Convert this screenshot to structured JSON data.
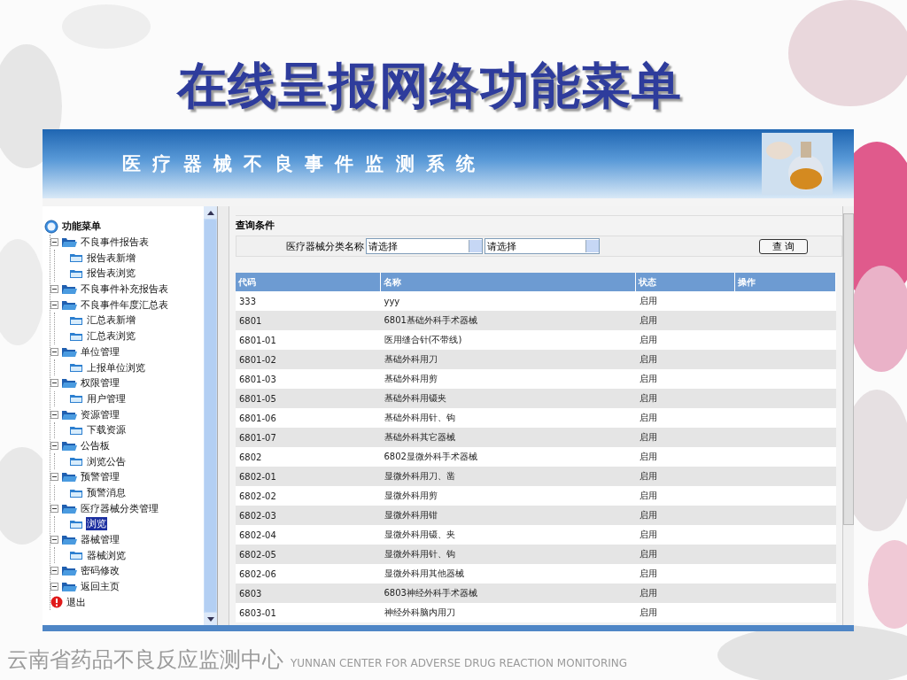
{
  "slide": {
    "title": "在线呈报网络功能菜单",
    "footer_cn": "云南省药品不良反应监测中心",
    "footer_en": "YUNNAN CENTER FOR ADVERSE DRUG REACTION MONITORING"
  },
  "app": {
    "banner_title": "医 疗 器 械 不 良 事 件 监 测 系 统"
  },
  "menu": {
    "label": "功能菜单",
    "kind": "root",
    "selected": false,
    "children": [
      {
        "label": "不良事件报告表",
        "kind": "folder",
        "selected": false,
        "children": [
          {
            "label": "报告表新增",
            "kind": "leaf",
            "selected": false
          },
          {
            "label": "报告表浏览",
            "kind": "leaf",
            "selected": false
          }
        ]
      },
      {
        "label": "不良事件补充报告表",
        "kind": "folder",
        "selected": false
      },
      {
        "label": "不良事件年度汇总表",
        "kind": "folder",
        "selected": false,
        "children": [
          {
            "label": "汇总表新增",
            "kind": "leaf",
            "selected": false
          },
          {
            "label": "汇总表浏览",
            "kind": "leaf",
            "selected": false
          }
        ]
      },
      {
        "label": "单位管理",
        "kind": "folder",
        "selected": false,
        "children": [
          {
            "label": "上报单位浏览",
            "kind": "leaf",
            "selected": false
          }
        ]
      },
      {
        "label": "权限管理",
        "kind": "folder",
        "selected": false,
        "children": [
          {
            "label": "用户管理",
            "kind": "leaf",
            "selected": false
          }
        ]
      },
      {
        "label": "资源管理",
        "kind": "folder",
        "selected": false,
        "children": [
          {
            "label": "下载资源",
            "kind": "leaf",
            "selected": false
          }
        ]
      },
      {
        "label": "公告板",
        "kind": "folder",
        "selected": false,
        "children": [
          {
            "label": "浏览公告",
            "kind": "leaf",
            "selected": false
          }
        ]
      },
      {
        "label": "预警管理",
        "kind": "folder",
        "selected": false,
        "children": [
          {
            "label": "预警消息",
            "kind": "leaf",
            "selected": false
          }
        ]
      },
      {
        "label": "医疗器械分类管理",
        "kind": "folder",
        "selected": false,
        "children": [
          {
            "label": "浏览",
            "kind": "leaf",
            "selected": true
          }
        ]
      },
      {
        "label": "器械管理",
        "kind": "folder",
        "selected": false,
        "children": [
          {
            "label": "器械浏览",
            "kind": "leaf",
            "selected": false
          }
        ]
      },
      {
        "label": "密码修改",
        "kind": "folder",
        "selected": false
      },
      {
        "label": "返回主页",
        "kind": "folder",
        "selected": false
      },
      {
        "label": "退出",
        "kind": "exit",
        "selected": false
      }
    ]
  },
  "query": {
    "heading": "查询条件",
    "field_label": "医疗器械分类名称",
    "select_1": "请选择",
    "select_2": "请选择",
    "button": "查 询"
  },
  "table": {
    "columns": [
      "代码",
      "名称",
      "状态",
      "操作"
    ],
    "rows": [
      [
        "333",
        "yyy",
        "启用"
      ],
      [
        "6801",
        "6801基础外科手术器械",
        "启用"
      ],
      [
        "6801-01",
        "医用缝合针(不带线)",
        "启用"
      ],
      [
        "6801-02",
        "基础外科用刀",
        "启用"
      ],
      [
        "6801-03",
        "基础外科用剪",
        "启用"
      ],
      [
        "6801-05",
        "基础外科用镊夹",
        "启用"
      ],
      [
        "6801-06",
        "基础外科用针、钩",
        "启用"
      ],
      [
        "6801-07",
        "基础外科其它器械",
        "启用"
      ],
      [
        "6802",
        "6802显微外科手术器械",
        "启用"
      ],
      [
        "6802-01",
        "显微外科用刀、凿",
        "启用"
      ],
      [
        "6802-02",
        "显微外科用剪",
        "启用"
      ],
      [
        "6802-03",
        "显微外科用钳",
        "启用"
      ],
      [
        "6802-04",
        "显微外科用镊、夹",
        "启用"
      ],
      [
        "6802-05",
        "显微外科用针、钩",
        "启用"
      ],
      [
        "6802-06",
        "显微外科用其他器械",
        "启用"
      ],
      [
        "6803",
        "6803神经外科手术器械",
        "启用"
      ],
      [
        "6803-01",
        "神经外科脑内用刀",
        "启用"
      ]
    ]
  }
}
